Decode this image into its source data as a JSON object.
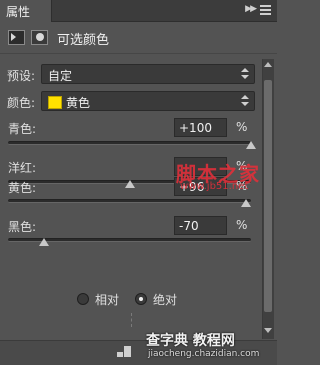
{
  "tab": {
    "label": "属性"
  },
  "title": {
    "label": "可选颜色"
  },
  "preset": {
    "label": "预设:",
    "value": "自定"
  },
  "colors": {
    "label": "颜色:",
    "value": "黄色",
    "swatch_color": "#ffe100"
  },
  "sliders": [
    {
      "label": "青色:",
      "value": "+100",
      "unit": "%",
      "level": 100
    },
    {
      "label": "洋红:",
      "value": "",
      "unit": "%",
      "level": 0
    },
    {
      "label": "黄色:",
      "value": "+96",
      "unit": "%",
      "level": 96
    },
    {
      "label": "黑色:",
      "value": "-70",
      "unit": "%",
      "level": -70
    }
  ],
  "method": {
    "relative": "相对",
    "absolute": "绝对",
    "selected": "absolute"
  },
  "watermark": {
    "brand": "脚本之家",
    "url": "www.jb51.net",
    "bottom_name": "查字典 教程网",
    "bottom_url": "jiaocheng.chazidian.com"
  }
}
